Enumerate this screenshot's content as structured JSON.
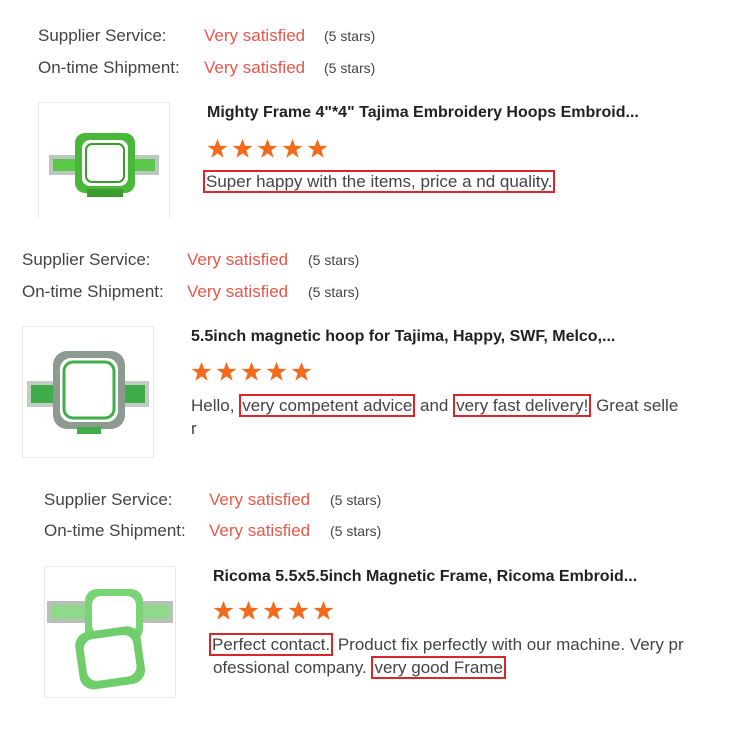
{
  "labels": {
    "supplier_service": "Supplier Service:",
    "on_time_shipment": "On-time Shipment:"
  },
  "colors": {
    "accent_red": "#e8574a",
    "star_orange": "#f26b1d",
    "highlight_box": "#d9262c"
  },
  "reviews": [
    {
      "supplier_value": "Very satisfied",
      "supplier_stars": "(5 stars)",
      "shipment_value": "Very satisfied",
      "shipment_stars": "(5 stars)",
      "product_title": "Mighty Frame 4\"*4\" Tajima Embroidery Hoops Embroid...",
      "product_rating": 5,
      "comment_hl1": "Super happy with the items, price a nd quality."
    },
    {
      "supplier_value": "Very satisfied",
      "supplier_stars": "(5 stars)",
      "shipment_value": "Very satisfied",
      "shipment_stars": "(5 stars)",
      "product_title": "5.5inch magnetic hoop for Tajima, Happy, SWF, Melco,...",
      "product_rating": 5,
      "comment_pre": "Hello, ",
      "comment_hl1": "very competent advice",
      "comment_mid": " and ",
      "comment_hl2": "very fast delivery!",
      "comment_post": " Great selle",
      "comment_line2": "r"
    },
    {
      "supplier_value": "Very satisfied",
      "supplier_stars": "(5 stars)",
      "shipment_value": "Very satisfied",
      "shipment_stars": "(5 stars)",
      "product_title": "Ricoma 5.5x5.5inch Magnetic Frame, Ricoma Embroid...",
      "product_rating": 5,
      "comment_hl1": "Perfect contact.",
      "comment_mid": " Product fix perfectly with our machine. Very pr",
      "comment_line2_pre": "ofessional company. ",
      "comment_hl2": "very good Frame"
    }
  ]
}
